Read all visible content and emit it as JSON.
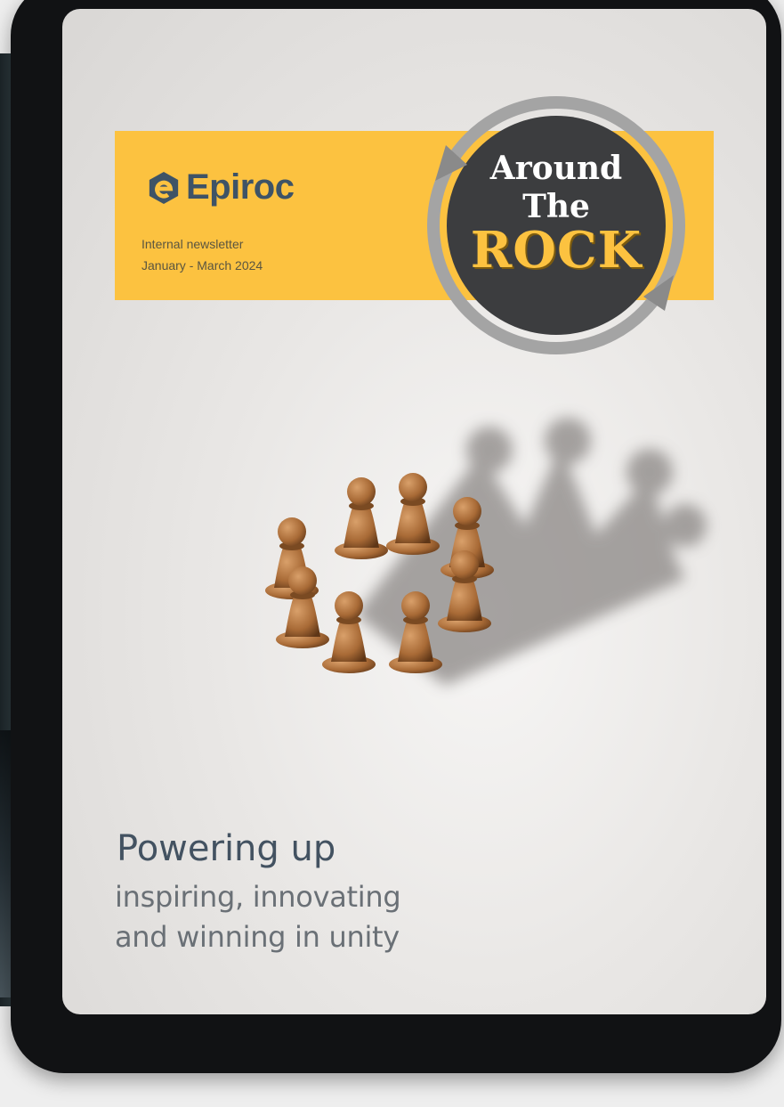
{
  "brand": {
    "name": "Epiroc",
    "color": "#3e5366",
    "banner_color": "#fcc240"
  },
  "newsletter": {
    "type_label": "Internal newsletter",
    "period": "January - March 2024"
  },
  "badge": {
    "line1": "Around",
    "line2": "The",
    "line3": "ROCK",
    "circle_color": "#3c3d3f",
    "ring_color": "#a4a4a4"
  },
  "cover": {
    "headline": "Powering up",
    "tagline_line1": "inspiring, innovating",
    "tagline_line2": "and winning in unity",
    "image_subject": "circle-of-pawns-with-crown-shadow"
  }
}
